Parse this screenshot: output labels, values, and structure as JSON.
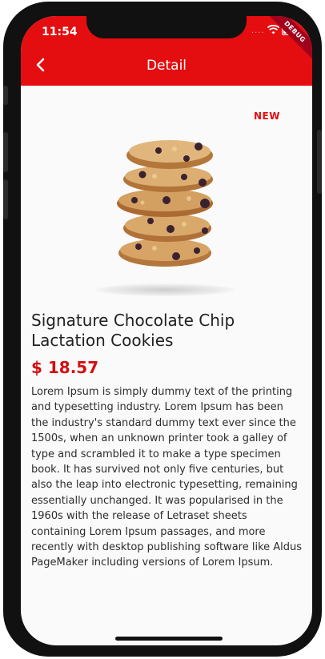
{
  "status_bar": {
    "time": "11:54",
    "dots": "····",
    "debug_label": "DEBUG"
  },
  "app_bar": {
    "title": "Detail",
    "back_icon": "chevron-left-icon",
    "background_color": "#e40d10"
  },
  "product": {
    "badge": "NEW",
    "title": "Signature Chocolate Chip Lactation Cookies",
    "price": "$ 18.57",
    "price_color": "#d40e12",
    "image": "cookie-stack",
    "description": "Lorem Ipsum is simply dummy text of the printing and typesetting industry. Lorem Ipsum has been the industry's standard dummy text ever since the 1500s, when an unknown printer took a galley of type and scrambled it to make a type specimen book. It has survived not only five centuries, but also the leap into electronic typesetting, remaining essentially unchanged. It was popularised in the 1960s with the release of Letraset sheets containing Lorem Ipsum passages, and more recently with desktop publishing software like Aldus PageMaker including versions of Lorem Ipsum."
  }
}
